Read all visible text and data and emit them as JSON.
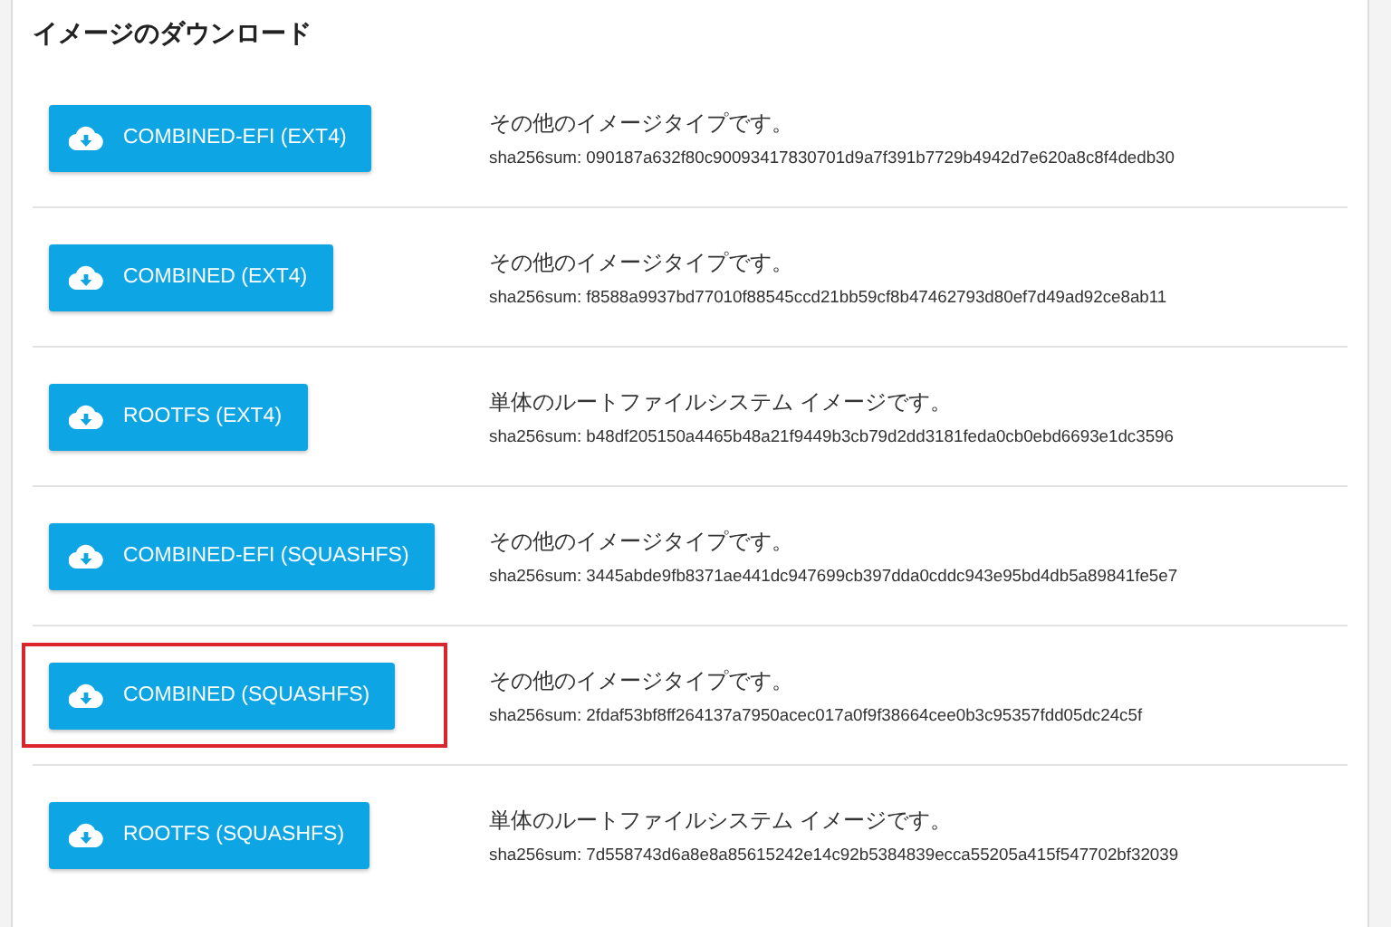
{
  "title": "イメージのダウンロード",
  "images": [
    {
      "button": "COMBINED-EFI (EXT4)",
      "description": "その他のイメージタイプです。",
      "checksum": "sha256sum: 090187a632f80c90093417830701d9a7f391b7729b4942d7e620a8c8f4dedb30",
      "highlighted": false
    },
    {
      "button": "COMBINED (EXT4)",
      "description": "その他のイメージタイプです。",
      "checksum": "sha256sum: f8588a9937bd77010f88545ccd21bb59cf8b47462793d80ef7d49ad92ce8ab11",
      "highlighted": false
    },
    {
      "button": "ROOTFS (EXT4)",
      "description": "単体のルートファイルシステム イメージです。",
      "checksum": "sha256sum: b48df205150a4465b48a21f9449b3cb79d2dd3181feda0cb0ebd6693e1dc3596",
      "highlighted": false
    },
    {
      "button": "COMBINED-EFI (SQUASHFS)",
      "description": "その他のイメージタイプです。",
      "checksum": "sha256sum: 3445abde9fb8371ae441dc947699cb397dda0cddc943e95bd4db5a89841fe5e7",
      "highlighted": false
    },
    {
      "button": "COMBINED (SQUASHFS)",
      "description": "その他のイメージタイプです。",
      "checksum": "sha256sum: 2fdaf53bf8ff264137a7950acec017a0f9f38664cee0b3c95357fdd05dc24c5f",
      "highlighted": true
    },
    {
      "button": "ROOTFS (SQUASHFS)",
      "description": "単体のルートファイルシステム イメージです。",
      "checksum": "sha256sum: 7d558743d6a8e8a85615242e14c92b5384839ecca55205a415f547702bf32039",
      "highlighted": false
    }
  ]
}
